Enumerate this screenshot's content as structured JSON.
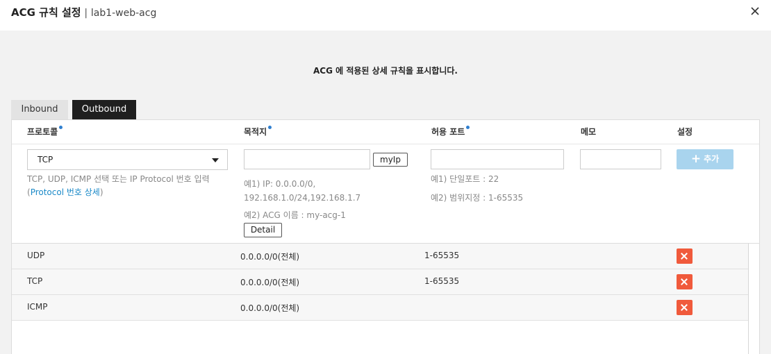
{
  "header": {
    "title": "ACG 규칙 설정",
    "separator": "|",
    "subtitle": "lab1-web-acg"
  },
  "description": "ACG 에 적용된 상세 규칙을 표시합니다.",
  "tabs": [
    {
      "label": "Inbound",
      "active": false
    },
    {
      "label": "Outbound",
      "active": true
    }
  ],
  "columns": {
    "protocol": "프로토콜",
    "destination": "목적지",
    "port": "허용 포트",
    "memo": "메모",
    "settings": "설정"
  },
  "form": {
    "protocol_value": "TCP",
    "protocol_hint": "TCP, UDP, ICMP 선택 또는 IP Protocol 번호 입력",
    "protocol_link_open": "(",
    "protocol_link": "Protocol 번호 상세",
    "protocol_link_close": ")",
    "myip_label": "myIp",
    "dest_hint1": "예1) IP: 0.0.0.0/0, 192.168.1.0/24,192.168.1.7",
    "dest_hint2": "예2) ACG 이름 : my-acg-1",
    "detail_label": "Detail",
    "port_hint1": "예1) 단일포트 : 22",
    "port_hint2": "예2) 범위지정 : 1-65535",
    "add_label": "추가"
  },
  "rules": [
    {
      "protocol": "UDP",
      "destination": "0.0.0.0/0(전체)",
      "port": "1-65535"
    },
    {
      "protocol": "TCP",
      "destination": "0.0.0.0/0(전체)",
      "port": "1-65535"
    },
    {
      "protocol": "ICMP",
      "destination": "0.0.0.0/0(전체)",
      "port": ""
    }
  ],
  "colors": {
    "accent_dot": "#2f7fcf",
    "add_button": "#a9d4ee",
    "delete_button": "#f05a3c",
    "link": "#1a89c8"
  }
}
